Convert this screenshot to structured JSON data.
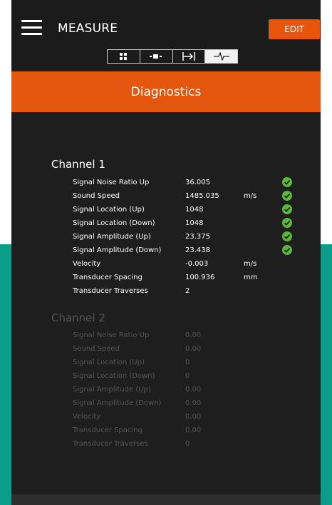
{
  "header": {
    "title": "MEASURE",
    "edit_label": "EDIT",
    "tabs": [
      {
        "icon": "grid-icon",
        "active": false
      },
      {
        "icon": "bar-icon",
        "active": false
      },
      {
        "icon": "arrow-bar-icon",
        "active": false
      },
      {
        "icon": "signal-pulse-icon",
        "active": true
      }
    ]
  },
  "banner": {
    "title": "Diagnostics"
  },
  "colors": {
    "accent": "#e5570f",
    "ok": "#5cb838",
    "background": "#1e1e1e"
  },
  "channel1": {
    "title": "Channel 1",
    "rows": [
      {
        "label": "Signal Noise Ratio Up",
        "value": "36.005",
        "unit": "",
        "ok": true
      },
      {
        "label": "Sound Speed",
        "value": "1485.035",
        "unit": "m/s",
        "ok": true
      },
      {
        "label": "Signal Location (Up)",
        "value": "1048",
        "unit": "",
        "ok": true
      },
      {
        "label": "Signal Location (Down)",
        "value": "1048",
        "unit": "",
        "ok": true
      },
      {
        "label": "Signal Amplitude (Up)",
        "value": "23.375",
        "unit": "",
        "ok": true
      },
      {
        "label": "Signal Amplitude (Down)",
        "value": "23.438",
        "unit": "",
        "ok": true
      },
      {
        "label": "Velocity",
        "value": "-0.003",
        "unit": "m/s",
        "ok": false
      },
      {
        "label": "Transducer Spacing",
        "value": "100.936",
        "unit": "mm",
        "ok": false
      },
      {
        "label": "Transducer Traverses",
        "value": "2",
        "unit": "",
        "ok": false
      }
    ]
  },
  "channel2": {
    "title": "Channel 2",
    "rows": [
      {
        "label": "Signal Noise Ratio Up",
        "value": "0.00"
      },
      {
        "label": "Sound Speed",
        "value": "0.00"
      },
      {
        "label": "Signal Location (Up)",
        "value": "0"
      },
      {
        "label": "Signal Location (Down)",
        "value": "0"
      },
      {
        "label": "Signal Amplitude (Up)",
        "value": "0.00"
      },
      {
        "label": "Signal Amplitude (Down)",
        "value": "0.00"
      },
      {
        "label": "Velocity",
        "value": "0.00"
      },
      {
        "label": "Transducer Spacing",
        "value": "0.00"
      },
      {
        "label": "Transducer Traverses",
        "value": "0"
      }
    ]
  }
}
